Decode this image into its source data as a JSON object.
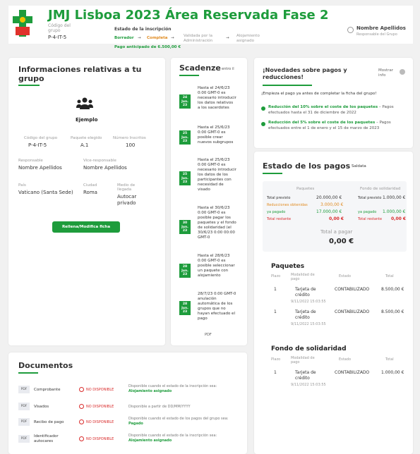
{
  "header": {
    "title": "JMJ Lisboa 2023 Área Reservada Fase 2",
    "group_code_label": "Código del grupo",
    "group_code": "P-4-IT-5",
    "status_label": "Estado de la inscripción",
    "steps": [
      "Borrador",
      "Completa",
      "Validada por la Administración",
      "Alojamiento asignado"
    ],
    "advance_paid": "Pago anticipado de 6.500,00 €",
    "user_name": "Nombre Apellidos",
    "user_role": "Responsable del Grupo"
  },
  "group": {
    "title": "Informaciones relativas a tu grupo",
    "type": "Ejemplo",
    "code_label": "Código del grupo",
    "code": "P-4-IT-5",
    "package_label": "Paquete elegido",
    "package": "A.1",
    "numbers_label": "Número Inscritos",
    "numbers": "100",
    "resp_label": "Responsable",
    "resp": "Nombre Apellidos",
    "vice_label": "Vice-responsable",
    "vice": "Nombre Apellidos",
    "country_label": "País",
    "country": "Vaticano (Santa Sede)",
    "city_label": "Ciudad",
    "city": "Roma",
    "transport_label": "Medio de llegada",
    "transport": "Autocar privado",
    "button": "Rellena/Modifica ficha"
  },
  "deadlines": {
    "title": "Scadenze",
    "subtitle": "entro il",
    "items": [
      {
        "date": "24 Jun. 23",
        "text": "Hasta el 24/6/23 0:00 GMT-0 es necesario introducir los datos relativos a los sacerdotes"
      },
      {
        "date": "25 Jun. 23",
        "text": "Hasta el 25/6/23 0:00 GMT-0 es posible crear nuevos subgrupos"
      },
      {
        "date": "25 Jun. 23",
        "text": "Hasta el 25/6/23 0:00 GMT-0 es necesario introducir los datos de los participantes con necesidad de visado"
      },
      {
        "date": "30 Jun. 23",
        "text": "Hasta el 30/6/23 0:00 GMT-0 es posible pagar los paquetes y el fondo de solidaridad (el 30/6/23 0:00 00:00 GMT-0"
      },
      {
        "date": "28 Jun. 23",
        "text": "Hasta el 28/6/23 0:00 GMT-0 es posible seleccionar un paquete con alojamiento"
      },
      {
        "date": "28 Jun. 23",
        "text": "28/7/23 0:00 GMT-0 anulación automática de los grupos que no hayan efectuado el pago"
      }
    ],
    "pdf": "PDF"
  },
  "news": {
    "title": "¡Novedades sobre pagos y reducciones!",
    "more": "Mostrar info",
    "intro": "¡Empieza el pago ya antes de completar la ficha del grupo!",
    "b1_bold": "Reducción del 10% sobre el coste de los paquetes",
    "b1_rest": " – Pagos efectuados hasta el 31 de diciembre de 2022",
    "b2_bold": "Reducción del 5% sobre el coste de los paquetes",
    "b2_rest": " – Pagos efectuados entre el 1 de enero y el 15 de marzo de 2023"
  },
  "payments": {
    "title": "Estado de los pagos",
    "subtitle": "Saldata",
    "col_packages": "Paquetes",
    "col_fund": "Fondo de solidaridad",
    "rows_left": [
      {
        "label": "Total previsto",
        "value": "20.000,00 €"
      },
      {
        "label": "Reducciones obtenidas",
        "value": "3.000,00 €"
      },
      {
        "label": "ya pagado",
        "value": "17.000,00 €"
      },
      {
        "label": "Total restante",
        "value": "0,00 €"
      }
    ],
    "rows_right": [
      {
        "label": "Total previsto",
        "value": "1.000,00 €"
      },
      {
        "label": "ya pagado",
        "value": "1.000,00 €"
      },
      {
        "label": "Total restante",
        "value": "0,00 €"
      }
    ],
    "total_label": "Total a pagar",
    "total": "0,00 €"
  },
  "packages": {
    "title": "Paquetes",
    "headers": [
      "Plazo",
      "Modalidad de pago",
      "Estado",
      "Total"
    ],
    "rows": [
      {
        "n": "1",
        "method": "Tarjeta de crédito",
        "date": "9/11/2022 15:03:55",
        "status": "CONTABILIZADO",
        "total": "8.500,00 €"
      },
      {
        "n": "1",
        "method": "Tarjeta de crédito",
        "date": "9/11/2022 15:03:55",
        "status": "CONTABILIZADO",
        "total": "8.500,00 €"
      }
    ]
  },
  "fund": {
    "title": "Fondo de solidaridad",
    "headers": [
      "Plazo",
      "Modalidad de pago",
      "Estado",
      "Total"
    ],
    "rows": [
      {
        "n": "1",
        "method": "Tarjeta de crédito",
        "date": "9/11/2022 15:03:55",
        "status": "CONTABILIZADO",
        "total": "1.000,00 €"
      }
    ]
  },
  "documents": {
    "title": "Documentos",
    "rows": [
      {
        "type": "PDF",
        "name": "Comprobante",
        "status": "NO DISPONIBLE",
        "desc": "Disponible cuando el estado de la inscripción sea: ",
        "desc_bold": "Alojamiento asignado"
      },
      {
        "type": "PDF",
        "name": "Visados",
        "status": "NO DISPONIBLE",
        "desc": "Disponible a partir de DD/MM/YYYY",
        "desc_bold": ""
      },
      {
        "type": "PDF",
        "name": "Recibo de pago",
        "status": "NO DISPONIBLE",
        "desc": "Disponible cuando el estado de los pagos del grupo sea: ",
        "desc_bold": "Pagado"
      },
      {
        "type": "PDF",
        "name": "Identificador autocares",
        "status": "NO DISPONIBLE",
        "desc": "Disponible cuando el estado de la inscripción sea: ",
        "desc_bold": "Alojamiento asignado"
      }
    ]
  },
  "colors": {
    "accent": "#1e9c3c",
    "danger": "#d92b2b",
    "warning": "#e08a1f"
  }
}
